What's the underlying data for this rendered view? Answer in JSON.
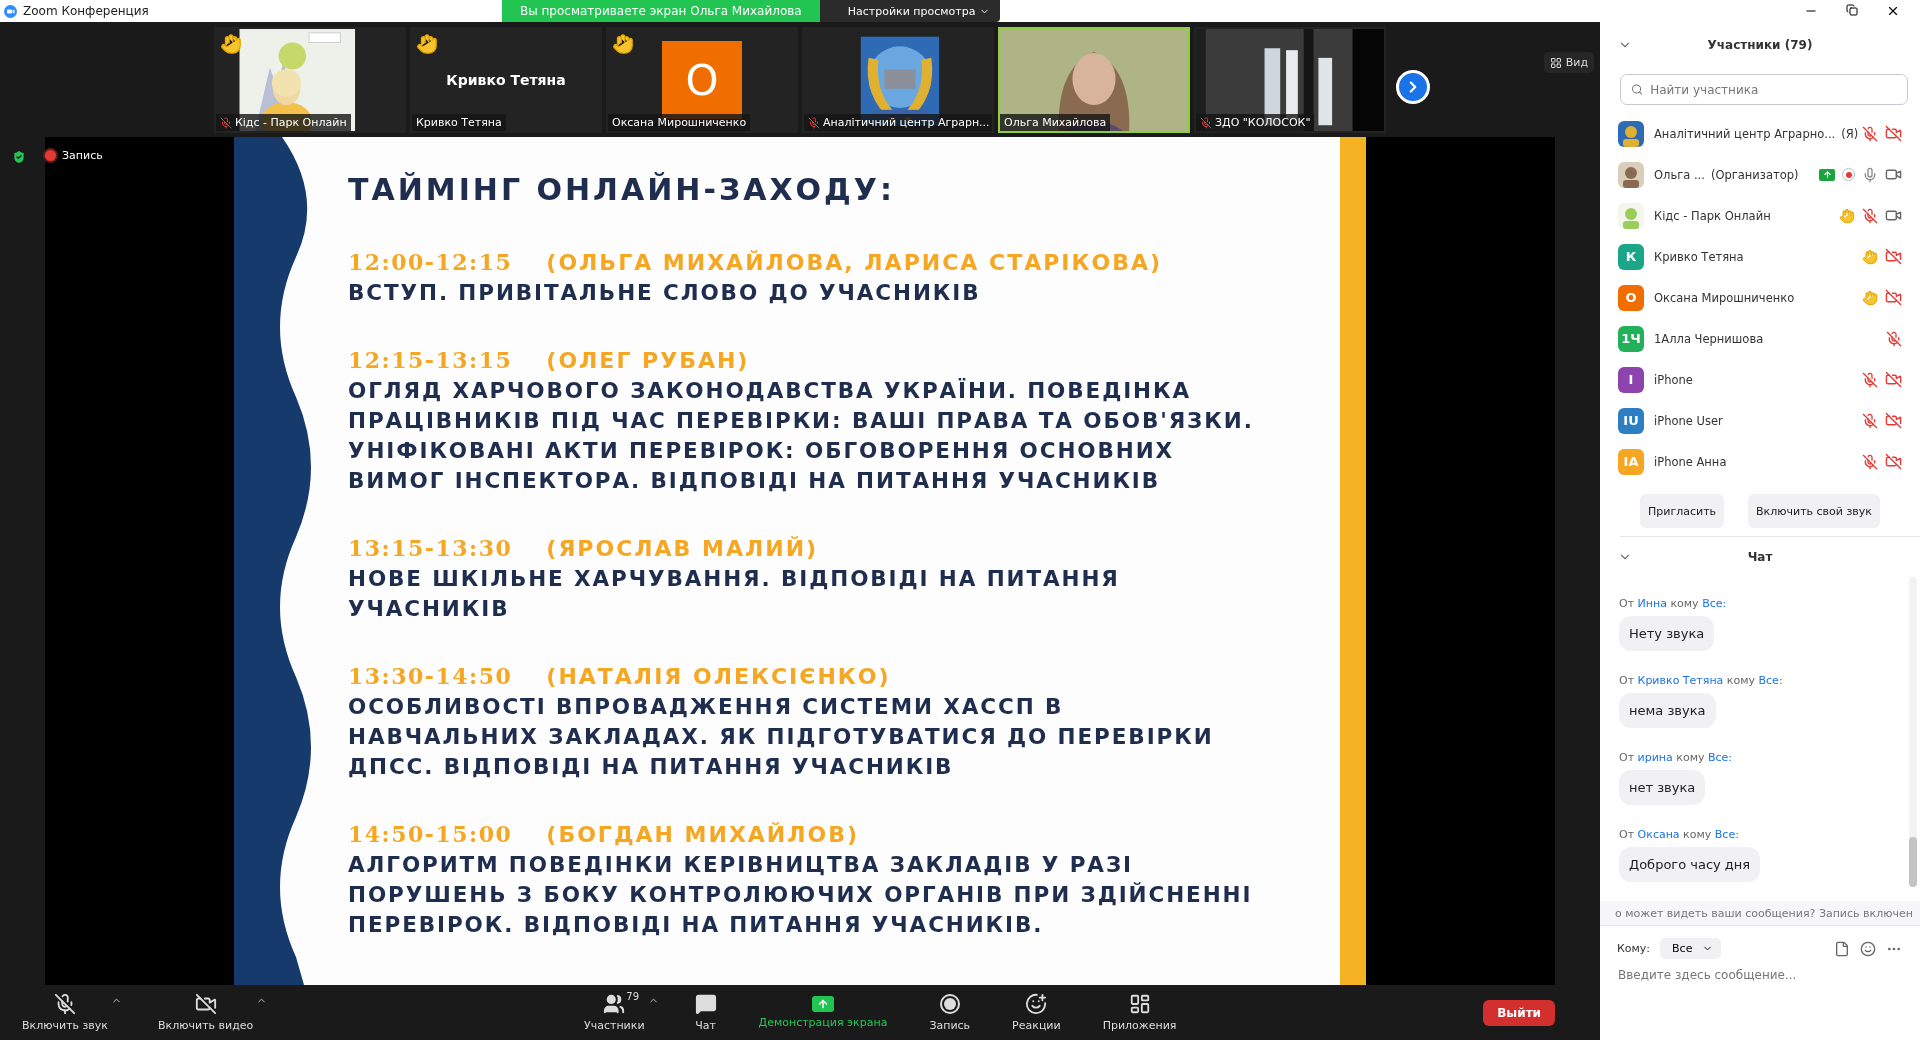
{
  "window": {
    "title": "Zoom Конференция"
  },
  "share_banner": {
    "text": "Вы просматриваете экран Ольга Михайлова",
    "menu": "Настройки просмотра"
  },
  "thumbnails": [
    {
      "name": "Кідс - Парк Онлайн",
      "kind": "picture",
      "muted": true,
      "hand": true,
      "active": false
    },
    {
      "name": "Кривко Тетяна",
      "kind": "name",
      "display": "Кривко Тетяна",
      "muted": false,
      "hand": true,
      "active": false
    },
    {
      "name": "Оксана Мирошниченко",
      "kind": "initial",
      "initial": "О",
      "muted": false,
      "hand": true,
      "active": false
    },
    {
      "name": "Аналітичний центр Аграрн...",
      "kind": "picture",
      "muted": true,
      "hand": false,
      "active": false
    },
    {
      "name": "Ольга Михайлова",
      "kind": "picture",
      "muted": false,
      "hand": false,
      "active": true
    },
    {
      "name": "ЗДО \"КОЛОСОК\"",
      "kind": "picture",
      "muted": true,
      "hand": false,
      "active": false
    }
  ],
  "view_button": "Вид",
  "recording_indicator": "Запись",
  "slide": {
    "title": "ТАЙМІНГ ОНЛАЙН-ЗАХОДУ:",
    "schedule": [
      {
        "time": "12:00-12:15",
        "speakers": "(ОЛЬГА МИХАЙЛОВА, ЛАРИСА СТАРІКОВА)",
        "lines": [
          "ВСТУП. ПРИВІТАЛЬНЕ СЛОВО ДО УЧАСНИКІВ"
        ]
      },
      {
        "time": "12:15-13:15",
        "speakers": "(ОЛЕГ РУБАН)",
        "lines": [
          "ОГЛЯД ХАРЧОВОГО ЗАКОНОДАВСТВА УКРАЇНИ. ПОВЕДІНКА",
          "ПРАЦІВНИКІВ ПІД ЧАС ПЕРЕВІРКИ: ВАШІ ПРАВА ТА ОБОВ'ЯЗКИ.",
          "УНІФІКОВАНІ АКТИ ПЕРЕВІРОК: ОБГОВОРЕННЯ ОСНОВНИХ",
          "ВИМОГ ІНСПЕКТОРА. ВІДПОВІДІ НА ПИТАННЯ УЧАСНИКІВ"
        ]
      },
      {
        "time": "13:15-13:30",
        "speakers": "(ЯРОСЛАВ МАЛИЙ)",
        "lines": [
          "НОВЕ ШКІЛЬНЕ ХАРЧУВАННЯ. ВІДПОВІДІ НА ПИТАННЯ",
          "УЧАСНИКІВ"
        ]
      },
      {
        "time": "13:30-14:50",
        "speakers": "(НАТАЛІЯ ОЛЕКСІЄНКО)",
        "lines": [
          "ОСОБЛИВОСТІ ВПРОВАДЖЕННЯ СИСТЕМИ ХАССП В",
          "НАВЧАЛЬНИХ ЗАКЛАДАХ. ЯК ПІДГОТУВАТИСЯ ДО ПЕРЕВІРКИ",
          "ДПСС. ВІДПОВІДІ НА ПИТАННЯ УЧАСНИКІВ"
        ]
      },
      {
        "time": "14:50-15:00",
        "speakers": "(БОГДАН МИХАЙЛОВ)",
        "lines": [
          "АЛГОРИТМ ПОВЕДІНКИ КЕРІВНИЦТВА ЗАКЛАДІВ У РАЗІ",
          "ПОРУШЕНЬ З БОКУ КОНТРОЛЮЮЧИХ ОРГАНІВ ПРИ ЗДІЙСНЕННІ",
          "ПЕРЕВІРОК. ВІДПОВІДІ НА ПИТАННЯ УЧАСНИКІВ."
        ]
      }
    ]
  },
  "toolbar": {
    "items": [
      {
        "kind": "mic",
        "label": "Включить звук",
        "muted": true,
        "caret": true
      },
      {
        "kind": "video",
        "label": "Включить видео",
        "muted": true,
        "caret": true
      },
      {
        "kind": "participants",
        "label": "Участники",
        "count": "79",
        "caret": true
      },
      {
        "kind": "chat",
        "label": "Чат",
        "caret": false
      },
      {
        "kind": "share",
        "label": "Демонстрация экрана",
        "caret": false
      },
      {
        "kind": "record",
        "label": "Запись",
        "caret": false
      },
      {
        "kind": "reactions",
        "label": "Реакции",
        "caret": false
      },
      {
        "kind": "apps",
        "label": "Приложения",
        "caret": false
      }
    ],
    "leave": "Выйти"
  },
  "participants": {
    "title": "Участники (79)",
    "search_placeholder": "Найти участника",
    "rows": [
      {
        "name": "Аналітичний центр Аграрно...",
        "suffix": "(Я)",
        "avatar": {
          "kind": "picture"
        },
        "icons": [
          {
            "kind": "mic",
            "muted": true
          },
          {
            "kind": "video",
            "off": true
          }
        ]
      },
      {
        "name": "Ольга ...",
        "suffix": "(Организатор)",
        "avatar": {
          "kind": "picture"
        },
        "icons": [
          {
            "kind": "share"
          },
          {
            "kind": "record"
          },
          {
            "kind": "mic",
            "muted": false
          },
          {
            "kind": "video",
            "off": false
          }
        ]
      },
      {
        "name": "Кідс - Парк Онлайн",
        "avatar": {
          "kind": "picture"
        },
        "icons": [
          {
            "kind": "hand"
          },
          {
            "kind": "mic",
            "muted": true
          },
          {
            "kind": "video",
            "off": false
          }
        ]
      },
      {
        "name": "Кривко Тетяна",
        "avatar": {
          "kind": "initials",
          "initials": "К",
          "color": "#1ba589"
        },
        "icons": [
          {
            "kind": "hand"
          },
          {
            "kind": "video",
            "off": true
          }
        ]
      },
      {
        "name": "Оксана Мирошниченко",
        "avatar": {
          "kind": "initials",
          "initials": "О",
          "color": "#f26d00"
        },
        "icons": [
          {
            "kind": "hand"
          },
          {
            "kind": "video",
            "off": true
          }
        ]
      },
      {
        "name": "1Алла Чернишова",
        "avatar": {
          "kind": "initials",
          "initials": "1Ч",
          "color": "#23b05b"
        },
        "icons": [
          {
            "kind": "mic",
            "muted": true
          }
        ]
      },
      {
        "name": "iPhone",
        "avatar": {
          "kind": "initials",
          "initials": "I",
          "color": "#8e44ad"
        },
        "icons": [
          {
            "kind": "mic",
            "muted": true
          },
          {
            "kind": "video",
            "off": true
          }
        ]
      },
      {
        "name": "iPhone User",
        "avatar": {
          "kind": "initials",
          "initials": "IU",
          "color": "#2d7fc1"
        },
        "icons": [
          {
            "kind": "mic",
            "muted": true
          },
          {
            "kind": "video",
            "off": true
          }
        ]
      },
      {
        "name": "iPhone Анна",
        "avatar": {
          "kind": "initials",
          "initials": "IA",
          "color": "#f5a623"
        },
        "icons": [
          {
            "kind": "mic",
            "muted": true
          },
          {
            "kind": "video",
            "off": true
          }
        ]
      }
    ],
    "buttons": [
      "Пригласить",
      "Включить свой звук"
    ]
  },
  "chat": {
    "title": "Чат",
    "messages": [
      {
        "from_word": "От",
        "from": "Инна",
        "to_word": "кому",
        "to": "Все:",
        "text": "Нету звука"
      },
      {
        "from_word": "От",
        "from": "Кривко Тетяна",
        "to_word": "кому",
        "to": "Все:",
        "text": "нема звука"
      },
      {
        "from_word": "От",
        "from": "ирина",
        "to_word": "кому",
        "to": "Все:",
        "text": "нет звука"
      },
      {
        "from_word": "От",
        "from": "Оксана",
        "to_word": "кому",
        "to": "Все:",
        "text": "Доброго часу дня"
      }
    ],
    "notice": "о может видеть ваши сообщения? Запись включен",
    "to_label": "Кому:",
    "recipient": "Все",
    "placeholder": "Введите здесь сообщение..."
  }
}
